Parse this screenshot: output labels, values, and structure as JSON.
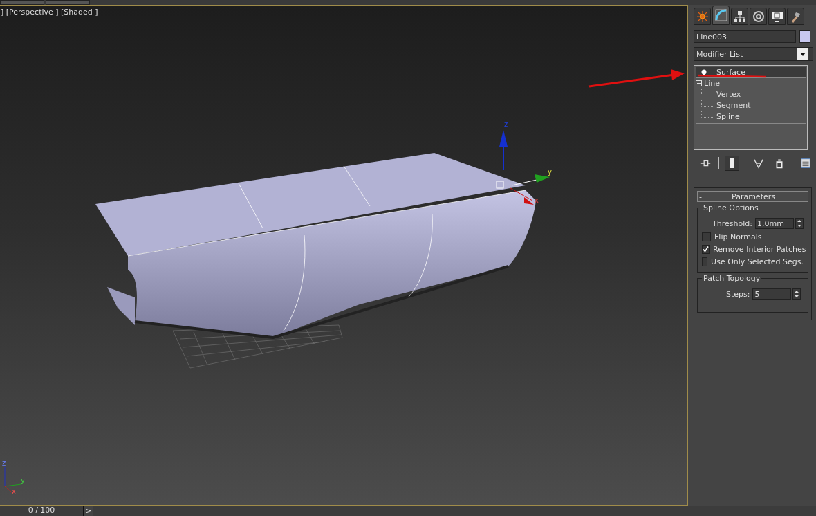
{
  "viewport": {
    "label": "] [Perspective ] [Shaded ]",
    "gizmo_axes": [
      "z",
      "y",
      "x"
    ],
    "corner_axes": [
      "z",
      "y",
      "x"
    ]
  },
  "command_panel": {
    "tabs": [
      {
        "kind": "create",
        "selected": false
      },
      {
        "kind": "modify",
        "selected": true
      },
      {
        "kind": "hierarchy",
        "selected": false
      },
      {
        "kind": "motion",
        "selected": false
      },
      {
        "kind": "display",
        "selected": false
      },
      {
        "kind": "utilities",
        "selected": false
      }
    ],
    "object_name": "Line003",
    "modifier_list": "Modifier List",
    "stack": [
      {
        "label": "Surface",
        "kind": "modifier",
        "selected": true
      },
      {
        "label": "Line",
        "kind": "object",
        "selected": false,
        "expanded": true,
        "children": [
          {
            "label": "Vertex"
          },
          {
            "label": "Segment"
          },
          {
            "label": "Spline"
          }
        ]
      }
    ],
    "stack_tools": [
      {
        "kind": "pin",
        "on": false
      },
      {
        "kind": "end-result",
        "on": true
      },
      {
        "kind": "unique",
        "on": false
      },
      {
        "kind": "remove",
        "on": false
      },
      {
        "kind": "configure",
        "on": false
      }
    ],
    "rollout": {
      "toggle": "-",
      "title": "Parameters",
      "spline_options": {
        "title": "Spline Options",
        "threshold_label": "Threshold:",
        "threshold_value": "1,0mm",
        "checkboxes": [
          {
            "label": "Flip Normals",
            "checked": false
          },
          {
            "label": "Remove Interior Patches",
            "checked": true
          },
          {
            "label": "Use Only Selected Segs.",
            "checked": false
          }
        ]
      },
      "patch_topology": {
        "title": "Patch Topology",
        "steps_label": "Steps:",
        "steps_value": "5"
      }
    }
  },
  "timeline": {
    "frame": "0 / 100",
    "next": ">"
  }
}
